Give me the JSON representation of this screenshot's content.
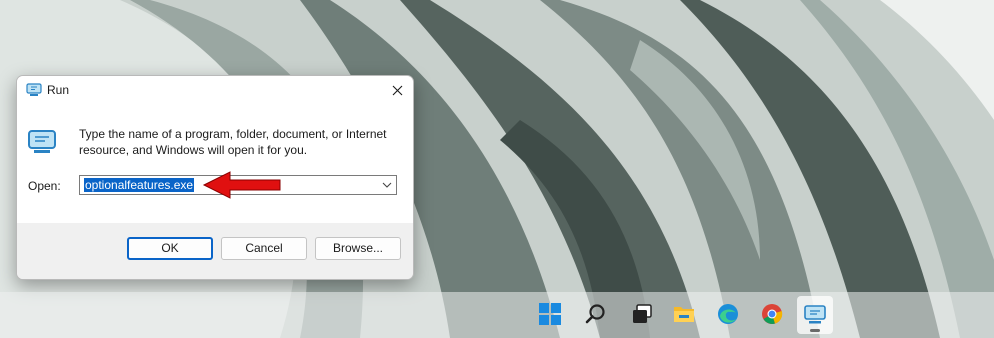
{
  "dialog": {
    "title": "Run",
    "description": "Type the name of a program, folder, document, or Internet resource, and Windows will open it for you.",
    "open_label": "Open:",
    "open_value": "optionalfeatures.exe",
    "ok_label": "OK",
    "cancel_label": "Cancel",
    "browse_label": "Browse..."
  },
  "taskbar": {
    "items": [
      "start",
      "search",
      "task-view",
      "file-explorer",
      "edge",
      "chrome",
      "run"
    ]
  },
  "colors": {
    "accent": "#0a64c8",
    "arrow": "#e01010"
  }
}
